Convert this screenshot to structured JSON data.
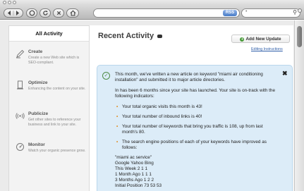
{
  "toolbar": {
    "back_icon": "back-arrow-icon",
    "forward_icon": "forward-arrow-icon",
    "stop_icon": "stop-icon",
    "reload_icon": "reload-icon",
    "home_icon": "home-icon",
    "rss_label": "RSS",
    "search_engine_label": "•"
  },
  "sidebar": {
    "tab_label": "All Activity",
    "items": [
      {
        "title": "Create",
        "desc": "Create a new Web site which is SEO-compliant.",
        "icon": "pen-icon"
      },
      {
        "title": "Optimize",
        "desc": "Enhancing the content on your site.",
        "icon": "document-icon"
      },
      {
        "title": "Publicize",
        "desc": "Get other sites to reference your business and link to your site.",
        "icon": "broadcast-icon"
      },
      {
        "title": "Monitor",
        "desc": "Watch your organic presence grow.",
        "icon": "gauge-icon"
      }
    ]
  },
  "main": {
    "title": "Recent Activity",
    "add_button": "Add New Update",
    "edit_link": "Editing Instructions",
    "notice": {
      "intro": "This month, we've written a new article on keyword \"miami air conditioning installation\" and submitted it to major article directories.",
      "status": "In has been 6 months since your site has launched. Your site is on-track with the following indicators:",
      "bullets": [
        "Your total organic visits this month is 43!",
        "Your total number of inbound links is 40!",
        "Your total number of keywords that bring you traffic is 108, up from last month's 80.",
        "The search engine positions of each of your keywords have improved as follows:"
      ],
      "data_lines": [
        "\"miami ac service\"",
        "Google Yahoo Bing",
        "This Week 2 1 1",
        "1 Month Ago 1 1 1",
        "3 Months Ago 1 2 2",
        "Initial Position 73 53 53"
      ]
    }
  }
}
